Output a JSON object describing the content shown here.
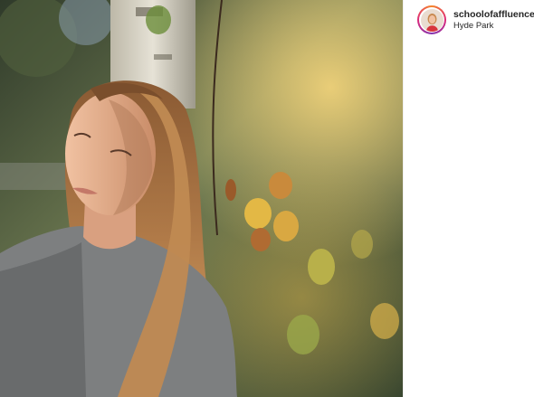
{
  "post": {
    "username": "schoolofaffluence",
    "location": "Hyde Park",
    "avatar_icon": "profile-avatar",
    "story_ring_colors": [
      "#f58529",
      "#dd2a7b",
      "#8134af"
    ]
  }
}
